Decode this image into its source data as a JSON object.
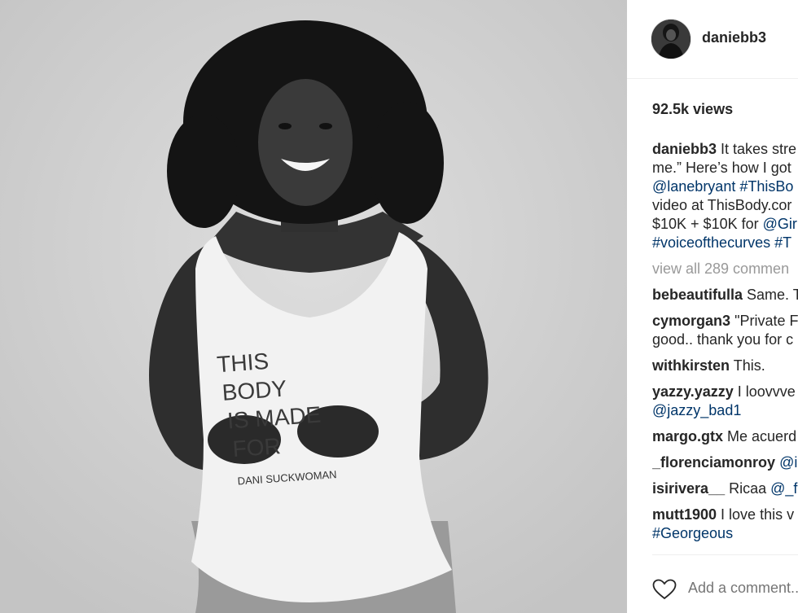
{
  "post": {
    "username": "daniebb3",
    "views": "92.5k views",
    "shirt_text": [
      "THIS",
      "BODY",
      "IS MADE",
      "FOR"
    ],
    "shirt_signature": "DANI SUCKWOMAN"
  },
  "caption": {
    "username": "daniebb3",
    "lines": [
      "It takes stre",
      "me.” Here’s how I got"
    ],
    "line3_tags": [
      "@lanebryant",
      "#ThisBo"
    ],
    "line4": "video at ThisBody.cor",
    "line5_text": "$10K + $10K for ",
    "line5_tag": "@Girl",
    "line6_tags": [
      "#voiceofthecurves",
      "#T"
    ]
  },
  "view_all": "view all 289 commen",
  "comments": [
    {
      "user": "bebeautifulla",
      "text": "Same. T",
      "cont": "",
      "tag": ""
    },
    {
      "user": "cymorgan3",
      "text": "\"Private F",
      "cont": "good.. thank you for c",
      "tag": ""
    },
    {
      "user": "withkirsten",
      "text": "This.",
      "cont": "",
      "tag": ""
    },
    {
      "user": "yazzy.yazzy",
      "text": "I loovvve",
      "cont": "",
      "tag": "@jazzy_bad1"
    },
    {
      "user": "margo.gtx",
      "text": "Me acuerd",
      "cont": "",
      "tag": ""
    },
    {
      "user": "_florenciamonroy",
      "text": "",
      "cont": "",
      "tag": "@is"
    },
    {
      "user": "isirivera__",
      "text": "Ricaa ",
      "cont": "",
      "tag": "@_fl"
    },
    {
      "user": "mutt1900",
      "text": "I love this v",
      "cont": "",
      "tag": "#Georgeous"
    }
  ],
  "add_comment_placeholder": "Add a comment...",
  "icons": {
    "like": "heart-icon"
  },
  "colors": {
    "link": "#003569",
    "muted": "#999999",
    "text": "#262626"
  }
}
